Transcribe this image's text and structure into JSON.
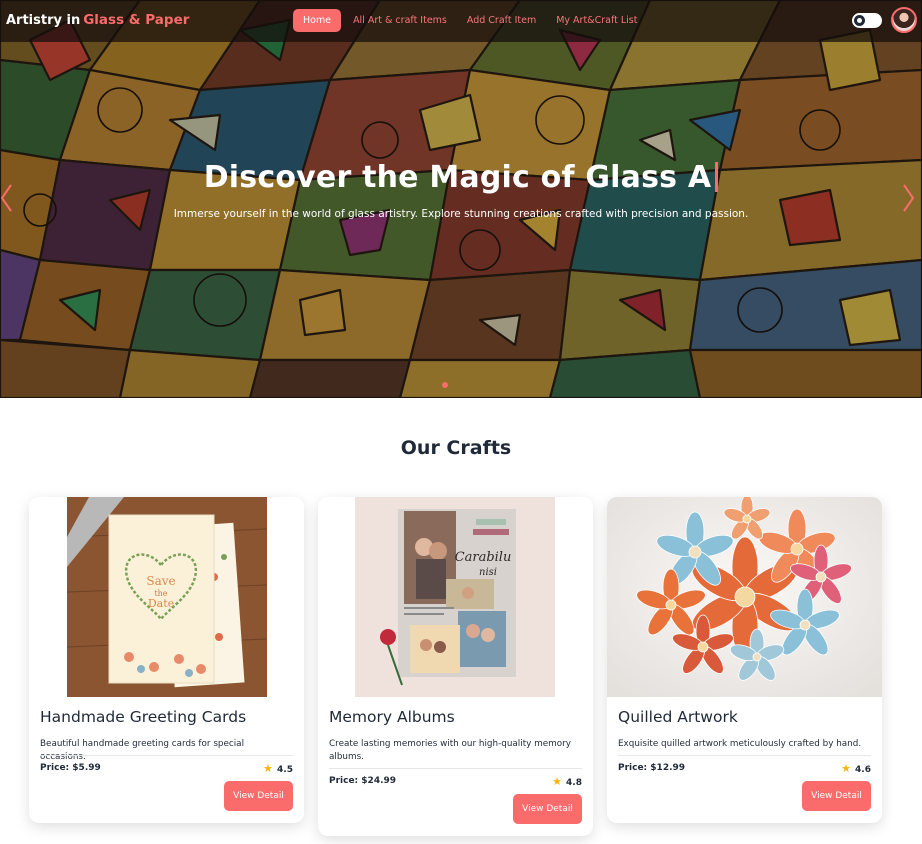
{
  "nav": {
    "brand_prefix": "Artistry  in",
    "brand_accent": "Glass & Paper",
    "links": [
      "Home",
      "All Art & craft Items",
      "Add Craft Item",
      "My Art&Craft List"
    ],
    "active": "Home"
  },
  "hero": {
    "title": "Discover the Magic of Glass A",
    "subtitle": "Immerse yourself in the world of glass artistry. Explore stunning creations crafted with precision and passion."
  },
  "section": {
    "title": "Our Crafts"
  },
  "crafts": [
    {
      "title": "Handmade Greeting Cards",
      "description": "Beautiful handmade greeting cards for special occasions.",
      "price": "Price: $5.99",
      "rating": "4.5",
      "button": "View Detail",
      "image_text": [
        "Save",
        "the",
        "Date"
      ]
    },
    {
      "title": "Memory Albums",
      "description": "Create lasting memories with our high-quality memory albums.",
      "price": "Price: $24.99",
      "rating": "4.8",
      "button": "View Detail",
      "image_text": [
        "Carabilu",
        "nisi"
      ]
    },
    {
      "title": "Quilled Artwork",
      "description": "Exquisite quilled artwork meticulously crafted by hand.",
      "price": "Price: $12.99",
      "rating": "4.6",
      "button": "View Detail",
      "image_text": []
    }
  ],
  "colors": {
    "accent": "#fa6b6b",
    "star": "#f5b50a",
    "text": "#1f2937"
  },
  "icons": [
    "chevron-left-icon",
    "chevron-right-icon",
    "star-icon",
    "theme-toggle-icon"
  ]
}
